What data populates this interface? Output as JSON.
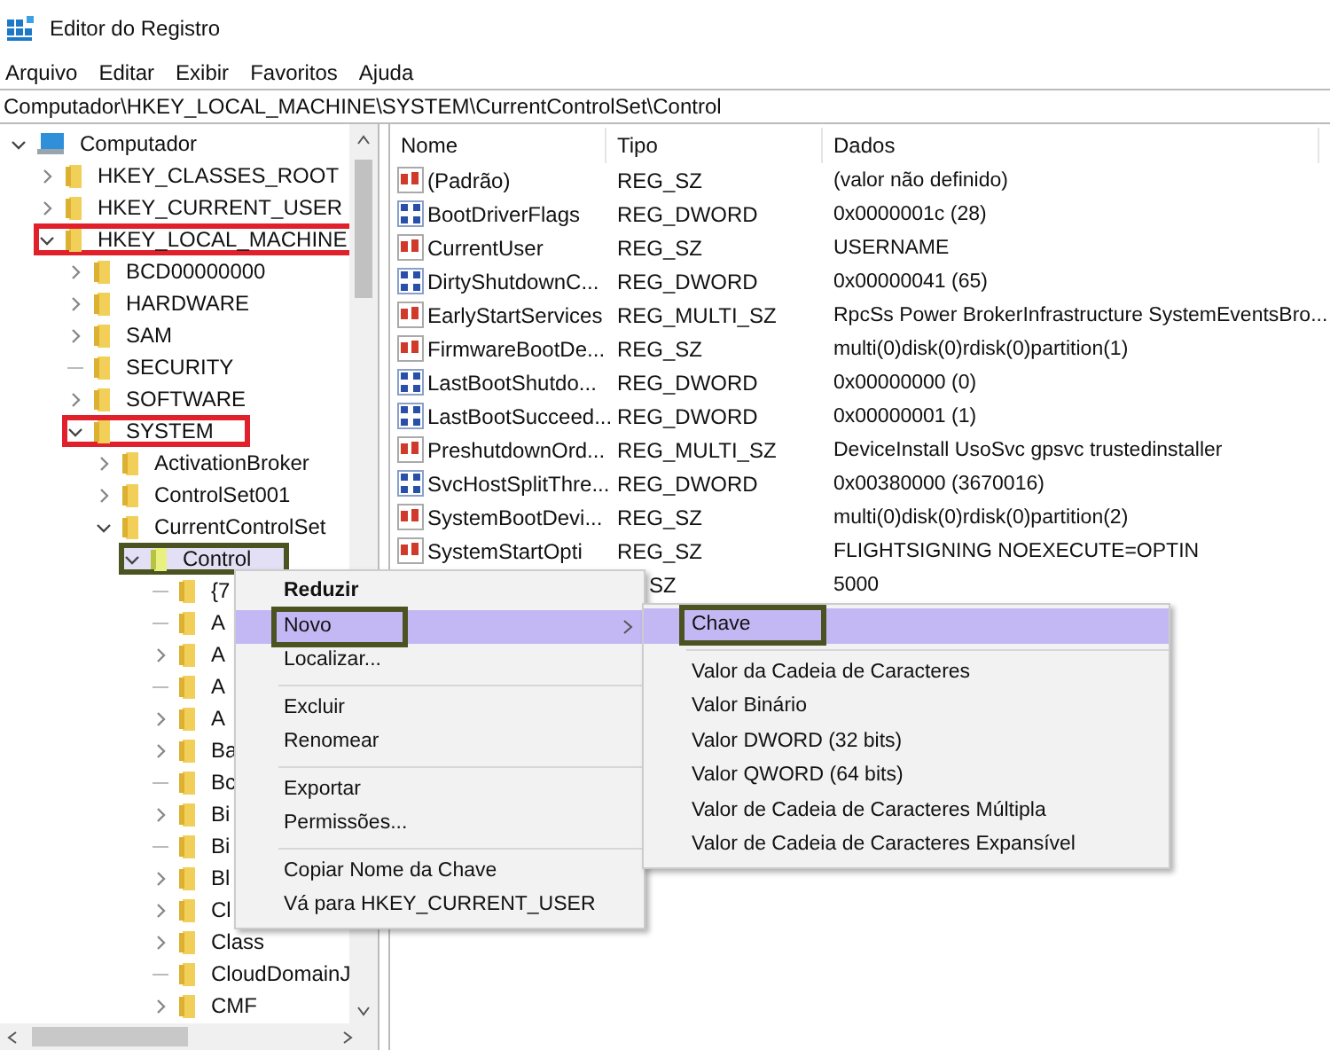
{
  "window": {
    "title": "Editor do Registro"
  },
  "menu_bar": [
    "Arquivo",
    "Editar",
    "Exibir",
    "Favoritos",
    "Ajuda"
  ],
  "address": "Computador\\HKEY_LOCAL_MACHINE\\SYSTEM\\CurrentControlSet\\Control",
  "tree": [
    {
      "label": "Computador",
      "has_children": true,
      "expanded": true,
      "selected": false,
      "children": [
        {
          "label": "HKEY_CLASSES_ROOT",
          "has_children": true,
          "expanded": false,
          "selected": false
        },
        {
          "label": "HKEY_CURRENT_USER",
          "has_children": true,
          "expanded": false,
          "selected": false
        },
        {
          "label": "HKEY_LOCAL_MACHINE",
          "has_children": true,
          "expanded": true,
          "selected": false,
          "color": "#e0202a",
          "children": [
            {
              "label": "BCD00000000",
              "has_children": true,
              "expanded": false,
              "selected": false
            },
            {
              "label": "HARDWARE",
              "has_children": true,
              "expanded": false,
              "selected": false
            },
            {
              "label": "SAM",
              "has_children": true,
              "expanded": false,
              "selected": false
            },
            {
              "label": "SECURITY",
              "has_children": false,
              "expanded": false,
              "selected": false
            },
            {
              "label": "SOFTWARE",
              "has_children": true,
              "expanded": false,
              "selected": false
            },
            {
              "label": "SYSTEM",
              "has_children": true,
              "expanded": true,
              "selected": false,
              "color": "#e0202a",
              "children": [
                {
                  "label": "ActivationBroker",
                  "has_children": true,
                  "expanded": false,
                  "selected": false
                },
                {
                  "label": "ControlSet001",
                  "has_children": true,
                  "expanded": false,
                  "selected": false
                },
                {
                  "label": "CurrentControlSet",
                  "has_children": true,
                  "expanded": true,
                  "selected": false,
                  "children": [
                    {
                      "label": "Control",
                      "has_children": true,
                      "expanded": true,
                      "selected": true,
                      "color": "#4b5320",
                      "children": [
                        {
                          "label": "{7",
                          "has_children": false,
                          "expanded": false,
                          "selected": false
                        },
                        {
                          "label": "A",
                          "has_children": false,
                          "expanded": false,
                          "selected": false
                        },
                        {
                          "label": "A",
                          "has_children": true,
                          "expanded": false,
                          "selected": false
                        },
                        {
                          "label": "A",
                          "has_children": false,
                          "expanded": false,
                          "selected": false
                        },
                        {
                          "label": "A",
                          "has_children": true,
                          "expanded": false,
                          "selected": false
                        },
                        {
                          "label": "Ba",
                          "has_children": true,
                          "expanded": false,
                          "selected": false
                        },
                        {
                          "label": "Bc",
                          "has_children": false,
                          "expanded": false,
                          "selected": false
                        },
                        {
                          "label": "Bi",
                          "has_children": true,
                          "expanded": false,
                          "selected": false
                        },
                        {
                          "label": "Bi",
                          "has_children": false,
                          "expanded": false,
                          "selected": false
                        },
                        {
                          "label": "Bl",
                          "has_children": true,
                          "expanded": false,
                          "selected": false
                        },
                        {
                          "label": "Cl",
                          "has_children": true,
                          "expanded": false,
                          "selected": false
                        },
                        {
                          "label": "Class",
                          "has_children": true,
                          "expanded": false,
                          "selected": false
                        },
                        {
                          "label": "CloudDomainJ",
                          "has_children": false,
                          "expanded": false,
                          "selected": false
                        },
                        {
                          "label": "CMF",
                          "has_children": true,
                          "expanded": false,
                          "selected": false
                        }
                      ]
                    }
                  ]
                }
              ]
            }
          ]
        }
      ]
    }
  ],
  "table": {
    "columns": [
      "Nome",
      "Tipo",
      "Dados"
    ],
    "rows": [
      {
        "kind": "string",
        "name": "(Padrão)",
        "type": "REG_SZ",
        "data": "(valor não definido)"
      },
      {
        "kind": "binary",
        "name": "BootDriverFlags",
        "type": "REG_DWORD",
        "data": "0x0000001c (28)"
      },
      {
        "kind": "string",
        "name": "CurrentUser",
        "type": "REG_SZ",
        "data": "USERNAME"
      },
      {
        "kind": "binary",
        "name": "DirtyShutdownC...",
        "type": "REG_DWORD",
        "data": "0x00000041 (65)"
      },
      {
        "kind": "string",
        "name": "EarlyStartServices",
        "type": "REG_MULTI_SZ",
        "data": "RpcSs Power BrokerInfrastructure SystemEventsBro..."
      },
      {
        "kind": "string",
        "name": "FirmwareBootDe...",
        "type": "REG_SZ",
        "data": "multi(0)disk(0)rdisk(0)partition(1)"
      },
      {
        "kind": "binary",
        "name": "LastBootShutdo...",
        "type": "REG_DWORD",
        "data": "0x00000000 (0)"
      },
      {
        "kind": "binary",
        "name": "LastBootSucceed...",
        "type": "REG_DWORD",
        "data": "0x00000001 (1)"
      },
      {
        "kind": "string",
        "name": "PreshutdownOrd...",
        "type": "REG_MULTI_SZ",
        "data": "DeviceInstall UsoSvc gpsvc trustedinstaller"
      },
      {
        "kind": "binary",
        "name": "SvcHostSplitThre...",
        "type": "REG_DWORD",
        "data": "0x00380000 (3670016)"
      },
      {
        "kind": "string",
        "name": "SystemBootDevi...",
        "type": "REG_SZ",
        "data": "multi(0)disk(0)rdisk(0)partition(2)"
      },
      {
        "kind": "string",
        "name": "SystemStartOpti",
        "type": "REG_SZ",
        "data": "FLIGHTSIGNING  NOEXECUTE=OPTIN"
      },
      {
        "type": "SZ",
        "data": "5000"
      }
    ]
  },
  "context_menu": {
    "items": [
      {
        "kind": "item",
        "label": "Reduzir",
        "default": true,
        "highlighted": false,
        "has_submenu": false
      },
      {
        "kind": "item",
        "label": "Novo",
        "default": false,
        "highlighted": true,
        "has_submenu": true,
        "color": "#4b5320"
      },
      {
        "kind": "item",
        "label": "Localizar...",
        "default": false,
        "highlighted": false,
        "has_submenu": false
      },
      {
        "kind": "separator"
      },
      {
        "kind": "item",
        "label": "Excluir",
        "default": false,
        "highlighted": false,
        "has_submenu": false
      },
      {
        "kind": "item",
        "label": "Renomear",
        "default": false,
        "highlighted": false,
        "has_submenu": false
      },
      {
        "kind": "separator"
      },
      {
        "kind": "item",
        "label": "Exportar",
        "default": false,
        "highlighted": false,
        "has_submenu": false
      },
      {
        "kind": "item",
        "label": "Permissões...",
        "default": false,
        "highlighted": false,
        "has_submenu": false
      },
      {
        "kind": "separator"
      },
      {
        "kind": "item",
        "label": "Copiar Nome da Chave",
        "default": false,
        "highlighted": false,
        "has_submenu": false
      },
      {
        "kind": "item",
        "label": "Vá para HKEY_CURRENT_USER",
        "default": false,
        "highlighted": false,
        "has_submenu": false
      }
    ]
  },
  "submenu": {
    "items": [
      {
        "kind": "item",
        "label": "Chave",
        "default": false,
        "highlighted": true,
        "has_submenu": false,
        "color": "#4b5320"
      },
      {
        "kind": "separator"
      },
      {
        "kind": "item",
        "label": "Valor da Cadeia de Caracteres",
        "default": false,
        "highlighted": false,
        "has_submenu": false
      },
      {
        "kind": "item",
        "label": "Valor Binário",
        "default": false,
        "highlighted": false,
        "has_submenu": false
      },
      {
        "kind": "item",
        "label": "Valor DWORD (32 bits)",
        "default": false,
        "highlighted": false,
        "has_submenu": false
      },
      {
        "kind": "item",
        "label": "Valor QWORD (64 bits)",
        "default": false,
        "highlighted": false,
        "has_submenu": false
      },
      {
        "kind": "item",
        "label": "Valor de Cadeia de Caracteres Múltipla",
        "default": false,
        "highlighted": false,
        "has_submenu": false
      },
      {
        "kind": "item",
        "label": "Valor de Cadeia de Caracteres Expansível",
        "default": false,
        "highlighted": false,
        "has_submenu": false
      }
    ]
  }
}
